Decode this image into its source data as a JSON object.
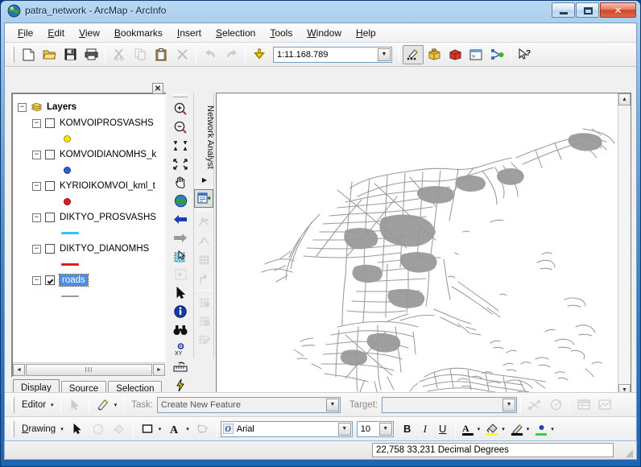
{
  "window": {
    "title": "patra_network - ArcMap - ArcInfo",
    "app_icon": "arcmap-globe-icon",
    "controls": {
      "minimize": "minimize-button",
      "maximize": "maximize-button",
      "close": "close-button",
      "close_glyph": "✕"
    }
  },
  "menubar": {
    "items": [
      {
        "label": "File",
        "mnemonic": "F"
      },
      {
        "label": "Edit",
        "mnemonic": "E"
      },
      {
        "label": "View",
        "mnemonic": "V"
      },
      {
        "label": "Bookmarks",
        "mnemonic": "B"
      },
      {
        "label": "Insert",
        "mnemonic": "I"
      },
      {
        "label": "Selection",
        "mnemonic": "S"
      },
      {
        "label": "Tools",
        "mnemonic": "T"
      },
      {
        "label": "Window",
        "mnemonic": "W"
      },
      {
        "label": "Help",
        "mnemonic": "H"
      }
    ]
  },
  "standard_toolbar": {
    "buttons": [
      {
        "name": "new-document-icon",
        "tip": "New Map File"
      },
      {
        "name": "open-folder-icon",
        "tip": "Open"
      },
      {
        "name": "save-disk-icon",
        "tip": "Save"
      },
      {
        "name": "print-icon",
        "tip": "Print"
      },
      {
        "name": "cut-scissors-icon",
        "tip": "Cut",
        "disabled": true
      },
      {
        "name": "copy-icon",
        "tip": "Copy",
        "disabled": true
      },
      {
        "name": "paste-clipboard-icon",
        "tip": "Paste"
      },
      {
        "name": "delete-x-icon",
        "tip": "Delete",
        "disabled": true
      },
      {
        "name": "undo-arrow-icon",
        "tip": "Undo",
        "disabled": true
      },
      {
        "name": "redo-arrow-icon",
        "tip": "Redo",
        "disabled": true
      },
      {
        "name": "add-data-icon",
        "tip": "Add Data"
      }
    ],
    "scale": {
      "value": "1:11.168.789",
      "label": "map-scale-combo"
    },
    "right_buttons": [
      {
        "name": "editor-toolbar-icon",
        "tip": "Editor Toolbar"
      },
      {
        "name": "arctoolbox-icon",
        "tip": "ArcToolbox"
      },
      {
        "name": "arccatalog-icon",
        "tip": "ArcCatalog"
      },
      {
        "name": "command-line-icon",
        "tip": "Command Line"
      },
      {
        "name": "model-builder-icon",
        "tip": "ModelBuilder"
      },
      {
        "name": "whats-this-help-icon",
        "tip": "What's This?"
      }
    ]
  },
  "toc": {
    "close_label": "✕",
    "root": {
      "label": "Layers",
      "expander": "−",
      "icon": "layers-stack-icon"
    },
    "layers": [
      {
        "name": "KOMVOIPROSVASHS",
        "checked": false,
        "expander": "−",
        "symbol_type": "point",
        "symbol_color": "#ffe400"
      },
      {
        "name": "KOMVOIDIANOMHS_k",
        "checked": false,
        "expander": "−",
        "symbol_type": "point",
        "symbol_color": "#2a5fd0"
      },
      {
        "name": "KYRIOIKOMVOI_kml_t",
        "checked": false,
        "expander": "−",
        "symbol_type": "point",
        "symbol_color": "#e01b1b"
      },
      {
        "name": "DIKTYO_PROSVASHS",
        "checked": false,
        "expander": "−",
        "symbol_type": "line",
        "symbol_color": "#35c6f0"
      },
      {
        "name": "DIKTYO_DIANOMHS",
        "checked": false,
        "expander": "−",
        "symbol_type": "line",
        "symbol_color": "#e01b1b"
      },
      {
        "name": "roads",
        "checked": true,
        "expander": "−",
        "symbol_type": "line",
        "symbol_color": "#9a9a9a",
        "selected": true
      }
    ],
    "scroll": {
      "left_arrow": "◄",
      "right_arrow": "►",
      "thumb_grip": "III"
    },
    "tabs": [
      {
        "label": "Display",
        "active": true
      },
      {
        "label": "Source",
        "active": false
      },
      {
        "label": "Selection",
        "active": false
      }
    ]
  },
  "tools_toolbar": {
    "buttons": [
      {
        "name": "zoom-in-icon"
      },
      {
        "name": "zoom-out-icon"
      },
      {
        "name": "fixed-zoom-in-icon"
      },
      {
        "name": "fixed-zoom-out-icon"
      },
      {
        "name": "pan-hand-icon"
      },
      {
        "name": "full-extent-globe-icon"
      },
      {
        "name": "previous-extent-icon"
      },
      {
        "name": "next-extent-icon"
      },
      {
        "name": "select-features-icon"
      },
      {
        "name": "select-elements-icon"
      },
      {
        "name": "pointer-arrow-icon"
      },
      {
        "name": "identify-info-icon"
      },
      {
        "name": "find-binoculars-icon"
      },
      {
        "name": "go-to-xy-icon"
      },
      {
        "name": "measure-ruler-icon"
      },
      {
        "name": "hyperlink-lightning-icon"
      },
      {
        "name": "html-popup-icon"
      }
    ]
  },
  "network_analyst": {
    "label": "Network Analyst",
    "dropdown_arrow": "▶",
    "buttons": [
      {
        "name": "network-analyst-window-icon",
        "disabled": false
      },
      {
        "name": "create-network-location-icon",
        "disabled": true
      },
      {
        "name": "select-network-location-icon",
        "disabled": true
      },
      {
        "name": "network-grid-icon",
        "disabled": true
      },
      {
        "name": "directions-icon",
        "disabled": true
      },
      {
        "name": "build-network-icon",
        "disabled": true
      },
      {
        "name": "network-identify-icon",
        "disabled": true
      },
      {
        "name": "network-edit-icon",
        "disabled": true
      }
    ]
  },
  "map": {
    "view_buttons": [
      {
        "name": "data-view-icon",
        "active": true
      },
      {
        "name": "layout-view-icon",
        "active": false
      },
      {
        "name": "refresh-view-icon",
        "active": false
      },
      {
        "name": "pause-drawing-icon",
        "active": false
      },
      {
        "name": "scroll-left-icon",
        "active": false
      }
    ],
    "scroll_up": "▲",
    "scroll_down": "▼",
    "roads_color": "#9a9a9a",
    "background": "#ffffff"
  },
  "editor_toolbar": {
    "menu_label": "Editor",
    "menu_caret": "▾",
    "edit_tool": "edit-pointer-icon",
    "sketch_tool": "sketch-pencil-icon",
    "sketch_caret": "▾",
    "task_label": "Task:",
    "task_value": "Create New Feature",
    "target_label": "Target:",
    "target_value": "",
    "right_buttons": [
      {
        "name": "sketch-properties-icon"
      },
      {
        "name": "rotate-tool-icon"
      },
      {
        "name": "attributes-table-icon"
      },
      {
        "name": "sketch-graph-icon"
      }
    ]
  },
  "drawing_toolbar": {
    "menu_label": "Drawing",
    "menu_caret": "▾",
    "select-elements": "select-elements-arrow-icon",
    "rotate": "rotate-element-icon",
    "paint": "paint-bucket-icon",
    "new_shape": "new-rectangle-icon",
    "new_shape_caret": "▾",
    "new_text": "new-text-A-icon",
    "new_text_caret": "▾",
    "edit_vertices": "edit-vertices-icon",
    "font_name": "Arial",
    "font_size": "10",
    "bold": "B",
    "italic": "I",
    "underline": "U",
    "font_color": {
      "name": "font-color-icon",
      "swatch": "#000000"
    },
    "fill_color": {
      "name": "fill-color-icon",
      "swatch": "#ffff00"
    },
    "line_color": {
      "name": "line-color-icon",
      "swatch": "#000000"
    },
    "marker_color": {
      "name": "marker-color-icon",
      "swatch": "#45c845"
    },
    "caret": "▾"
  },
  "status_bar": {
    "coordinates": "22,758  33,231 Decimal Degrees",
    "resize_grip": "resize-grip-icon"
  }
}
